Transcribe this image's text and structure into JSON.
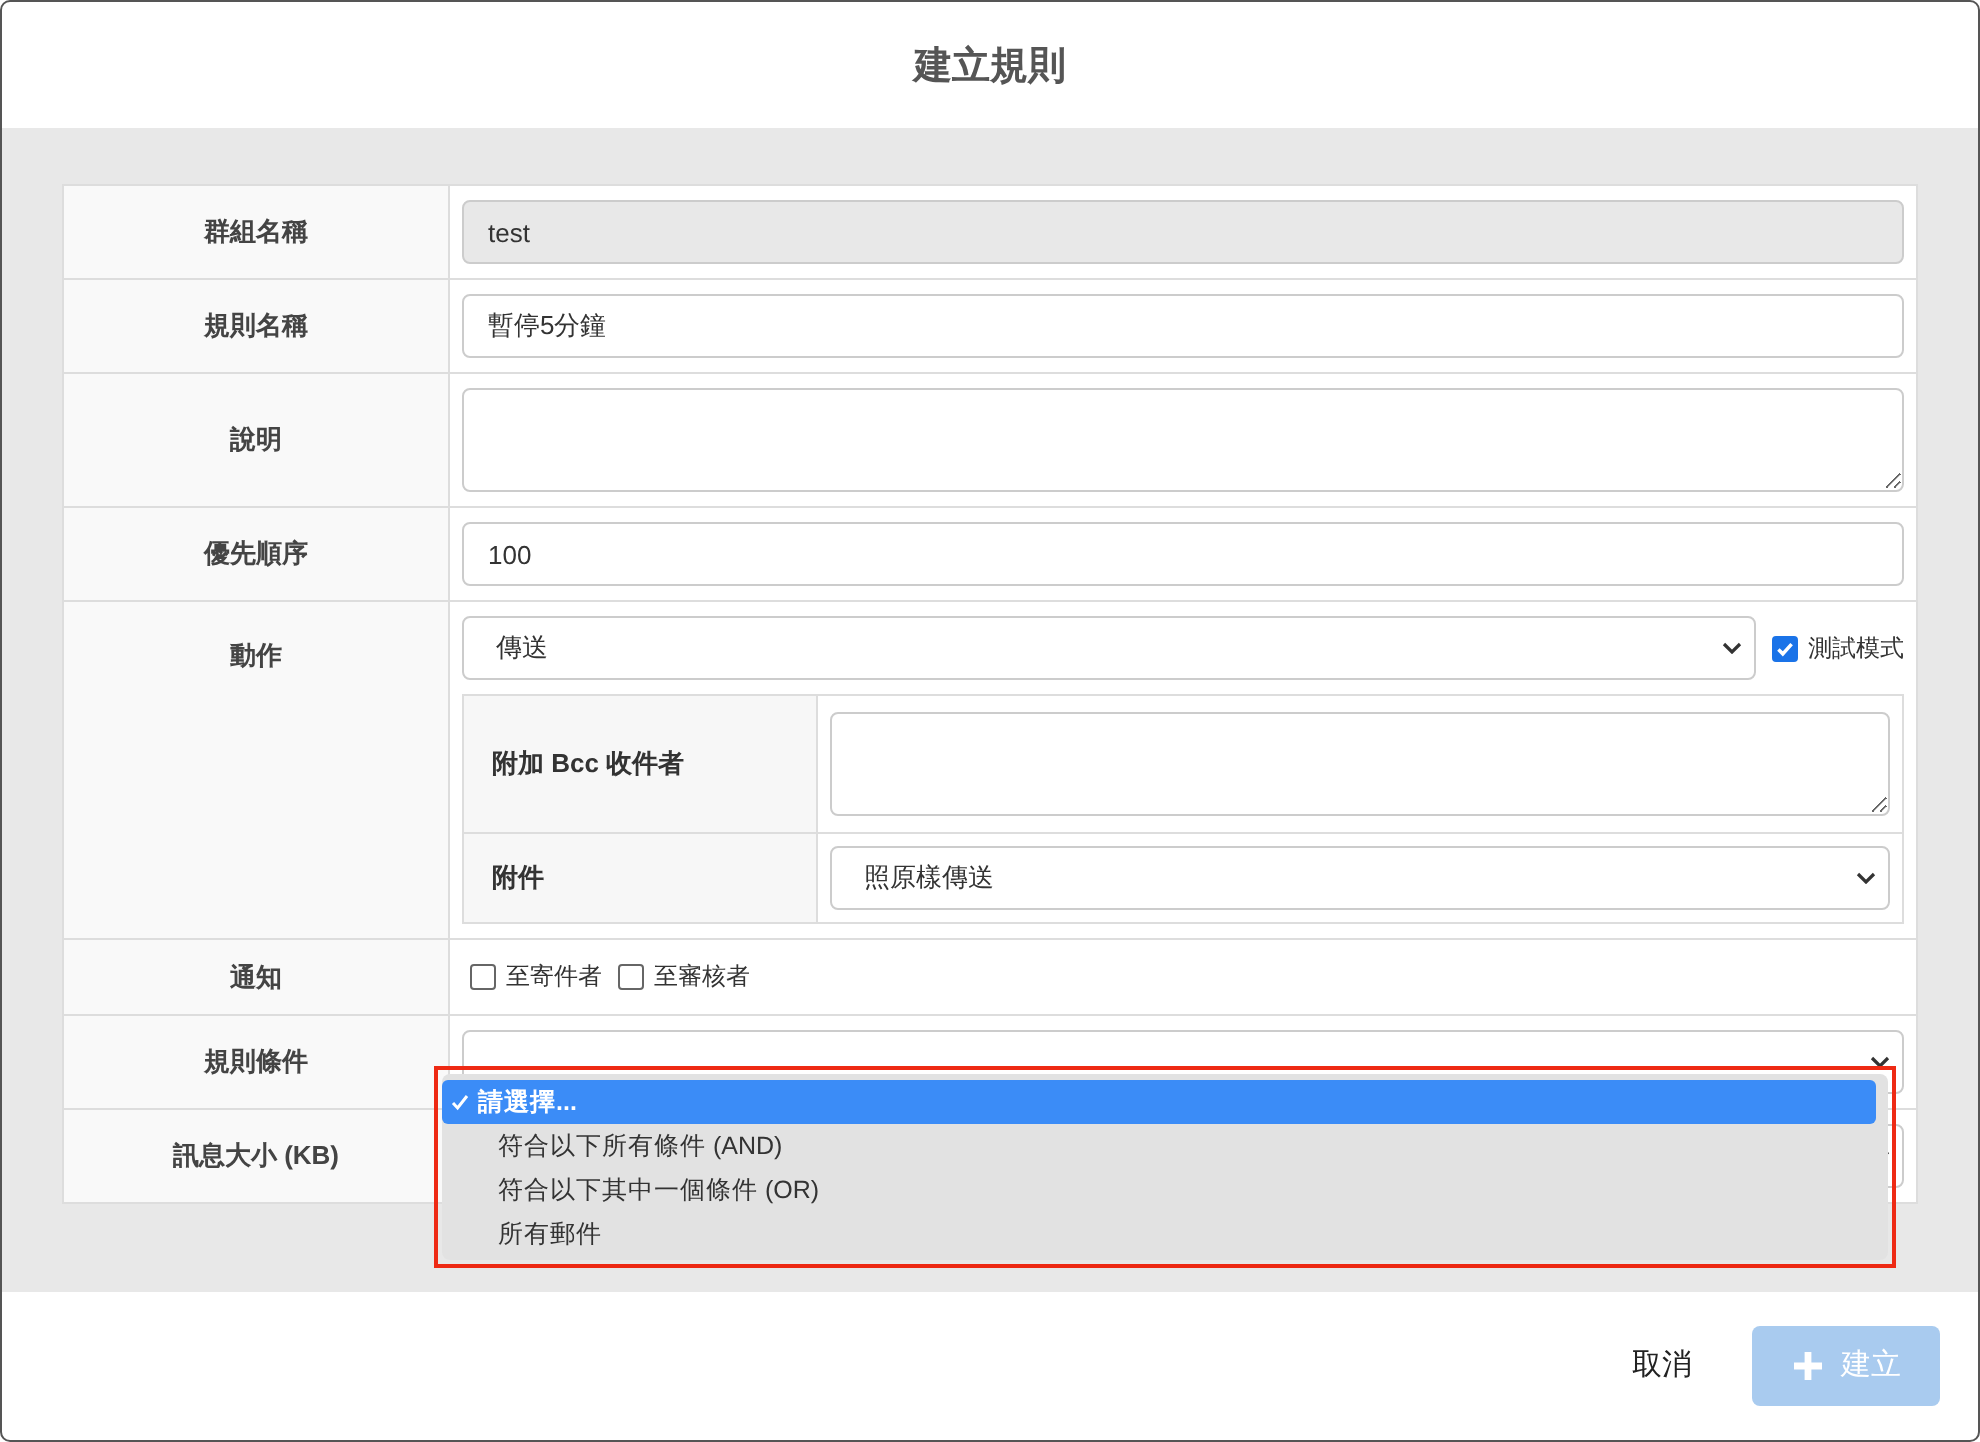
{
  "dialog": {
    "title": "建立規則"
  },
  "form": {
    "rows": [
      {
        "kind": "input",
        "label": "群組名稱",
        "value": "test",
        "disabled": true
      },
      {
        "kind": "input",
        "label": "規則名稱",
        "value": "暫停5分鐘",
        "disabled": false
      },
      {
        "kind": "textarea",
        "label": "說明"
      },
      {
        "kind": "input",
        "label": "優先順序",
        "value": "100",
        "disabled": false
      },
      {
        "kind": "action",
        "label": "動作",
        "select": "傳送",
        "test_mode": {
          "label": "測試模式",
          "checked": true
        },
        "sub_rows": [
          {
            "kind": "textarea",
            "label": "附加 Bcc 收件者"
          },
          {
            "kind": "select",
            "label": "附件",
            "value": "照原樣傳送"
          }
        ]
      },
      {
        "kind": "checkboxes",
        "label": "通知",
        "options": [
          {
            "label": "至寄件者",
            "checked": false
          },
          {
            "label": "至審核者",
            "checked": false
          }
        ]
      },
      {
        "kind": "select",
        "label": "規則條件",
        "value": ""
      },
      {
        "kind": "select",
        "label": "訊息大小 (KB)",
        "value": ""
      }
    ]
  },
  "dropdown": {
    "options": [
      {
        "label": "請選擇...",
        "selected": true
      },
      {
        "label": "符合以下所有條件 (AND)",
        "selected": false
      },
      {
        "label": "符合以下其中一個條件 (OR)",
        "selected": false
      },
      {
        "label": "所有郵件",
        "selected": false
      }
    ]
  },
  "footer": {
    "cancel": "取消",
    "create": {
      "label": "建立",
      "disabled": true
    }
  }
}
